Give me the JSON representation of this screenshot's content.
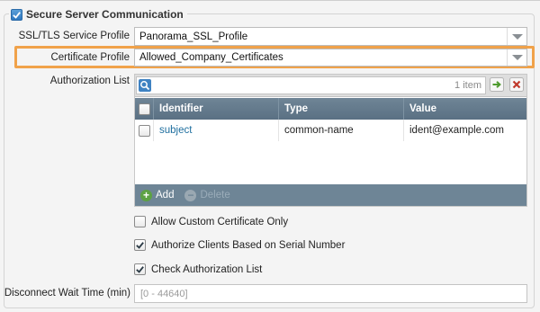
{
  "section": {
    "title": "Secure Server Communication",
    "checked": true
  },
  "fields": {
    "ssl_tls_label": "SSL/TLS Service Profile",
    "ssl_tls_value": "Panorama_SSL_Profile",
    "cert_profile_label": "Certificate Profile",
    "cert_profile_value": "Allowed_Company_Certificates",
    "auth_list_label": "Authorization List",
    "disconnect_label": "Disconnect Wait Time (min)",
    "disconnect_placeholder": "[0 - 44640]"
  },
  "auth_list": {
    "item_count": "1 item",
    "columns": [
      "Identifier",
      "Type",
      "Value"
    ],
    "rows": [
      {
        "identifier": "subject",
        "type": "common-name",
        "value": "ident@example.com"
      }
    ],
    "add_label": "Add",
    "delete_label": "Delete"
  },
  "options": [
    {
      "label": "Allow Custom Certificate Only",
      "checked": false
    },
    {
      "label": "Authorize Clients Based on Serial Number",
      "checked": true
    },
    {
      "label": "Check Authorization List",
      "checked": true
    }
  ],
  "colors": {
    "highlight": "#f0a24a",
    "grid_header": "#6f8596",
    "link": "#1f6f9f",
    "add_icon": "#5da244"
  }
}
